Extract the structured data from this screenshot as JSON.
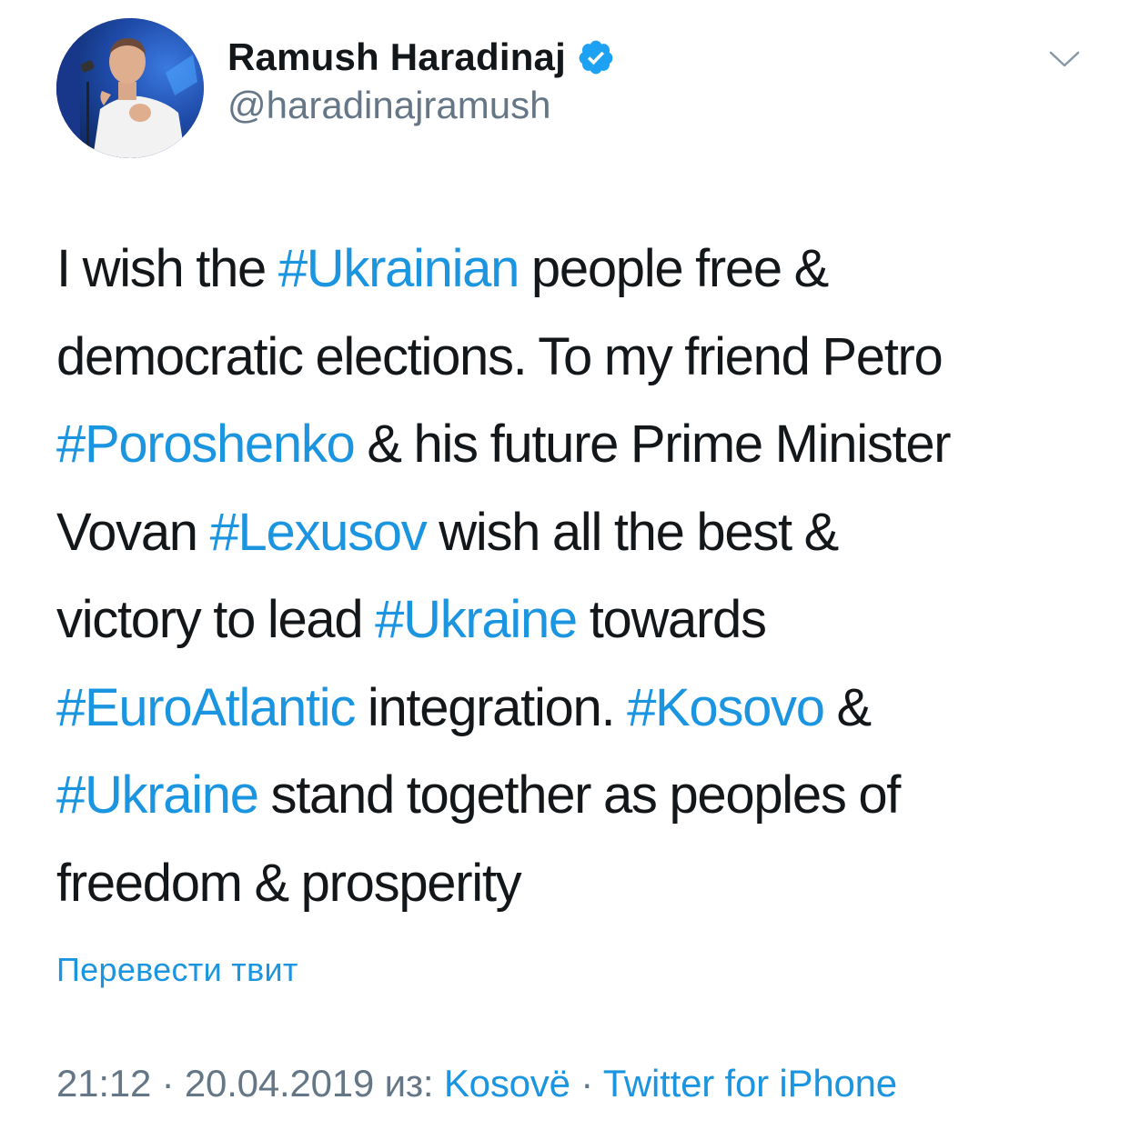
{
  "author": {
    "display_name": "Ramush Haradinaj",
    "handle": "@haradinajramush",
    "verified": true
  },
  "icons": {
    "verified": "verified-badge-icon",
    "menu": "chevron-down-icon"
  },
  "colors": {
    "link": "#1b95e0",
    "text": "#14171a",
    "secondary": "#657786"
  },
  "tweet": {
    "lines": [
      [
        {
          "text": "I wish the ",
          "hashtag": false
        },
        {
          "text": "#Ukrainian",
          "hashtag": true
        },
        {
          "text": " people free &",
          "hashtag": false
        }
      ],
      [
        {
          "text": "democratic elections. To my friend Petro",
          "hashtag": false
        }
      ],
      [
        {
          "text": "#Poroshenko",
          "hashtag": true
        },
        {
          "text": " & his future Prime Minister",
          "hashtag": false
        }
      ],
      [
        {
          "text": "Vovan ",
          "hashtag": false
        },
        {
          "text": "#Lexusov",
          "hashtag": true
        },
        {
          "text": " wish all the best &",
          "hashtag": false
        }
      ],
      [
        {
          "text": "victory to lead ",
          "hashtag": false
        },
        {
          "text": "#Ukraine",
          "hashtag": true
        },
        {
          "text": " towards",
          "hashtag": false
        }
      ],
      [
        {
          "text": "#EuroAtlantic",
          "hashtag": true
        },
        {
          "text": " integration. ",
          "hashtag": false
        },
        {
          "text": "#Kosovo",
          "hashtag": true
        },
        {
          "text": " &",
          "hashtag": false
        }
      ],
      [
        {
          "text": "#Ukraine",
          "hashtag": true
        },
        {
          "text": " stand together as peoples of",
          "hashtag": false
        }
      ],
      [
        {
          "text": "freedom & prosperity",
          "hashtag": false
        }
      ]
    ],
    "translate_label": "Перевести твит"
  },
  "meta": {
    "time": "21:12",
    "separator": "·",
    "date": "20.04.2019",
    "from_label": "из:",
    "location": "Kosovë",
    "source": "Twitter for iPhone"
  }
}
